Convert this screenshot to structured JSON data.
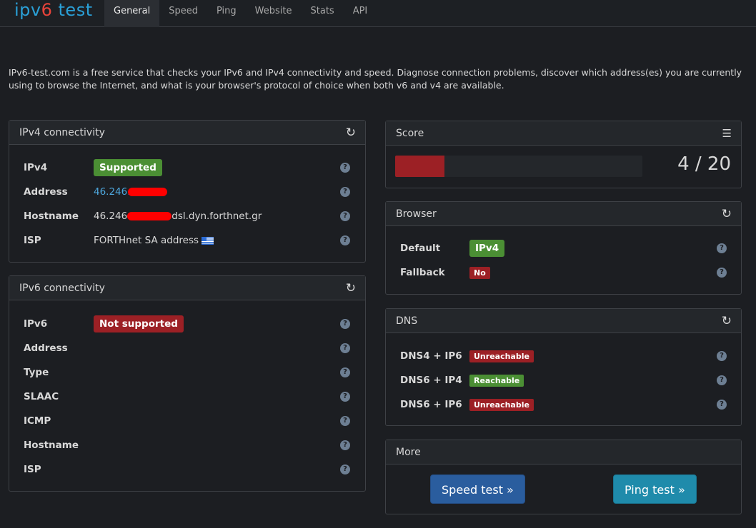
{
  "brand": {
    "part1": "ipv",
    "part2": "6",
    "part3": " test"
  },
  "nav": [
    {
      "label": "General",
      "active": true
    },
    {
      "label": "Speed"
    },
    {
      "label": "Ping"
    },
    {
      "label": "Website"
    },
    {
      "label": "Stats"
    },
    {
      "label": "API"
    }
  ],
  "intro": "IPv6-test.com is a free service that checks your IPv6 and IPv4 connectivity and speed. Diagnose connection problems, discover which address(es) you are currently using to browse the Internet, and what is your browser's protocol of choice when both v6 and v4 are available.",
  "ipv4": {
    "title": "IPv4 connectivity",
    "rows": [
      {
        "label": "IPv4",
        "badge": "Supported"
      },
      {
        "label": "Address",
        "value": "46.246."
      },
      {
        "label": "Hostname",
        "value_pre": "46.246",
        "value_post": "dsl.dyn.forthnet.gr"
      },
      {
        "label": "ISP",
        "value": "FORTHnet SA address"
      }
    ]
  },
  "ipv6": {
    "title": "IPv6 connectivity",
    "rows": [
      {
        "label": "IPv6",
        "badge": "Not supported"
      },
      {
        "label": "Address"
      },
      {
        "label": "Type"
      },
      {
        "label": "SLAAC"
      },
      {
        "label": "ICMP"
      },
      {
        "label": "Hostname"
      },
      {
        "label": "ISP"
      }
    ]
  },
  "score": {
    "title": "Score",
    "value": "4 / 20",
    "fraction": 0.2
  },
  "browser": {
    "title": "Browser",
    "rows": [
      {
        "label": "Default",
        "badge": "IPv4"
      },
      {
        "label": "Fallback",
        "badge": "No"
      }
    ]
  },
  "dns": {
    "title": "DNS",
    "rows": [
      {
        "label": "DNS4 + IP6",
        "badge": "Unreachable"
      },
      {
        "label": "DNS6 + IP4",
        "badge": "Reachable"
      },
      {
        "label": "DNS6 + IP6",
        "badge": "Unreachable"
      }
    ]
  },
  "more": {
    "title": "More",
    "speed_button": "Speed test »",
    "ping_button": "Ping test »"
  },
  "icons": {
    "refresh": "refresh-icon",
    "list": "list-icon",
    "help": "help-icon"
  },
  "colors": {
    "supported": "#4b8f34",
    "unsupported": "#9c2025",
    "accent": "#2a9fd6"
  }
}
